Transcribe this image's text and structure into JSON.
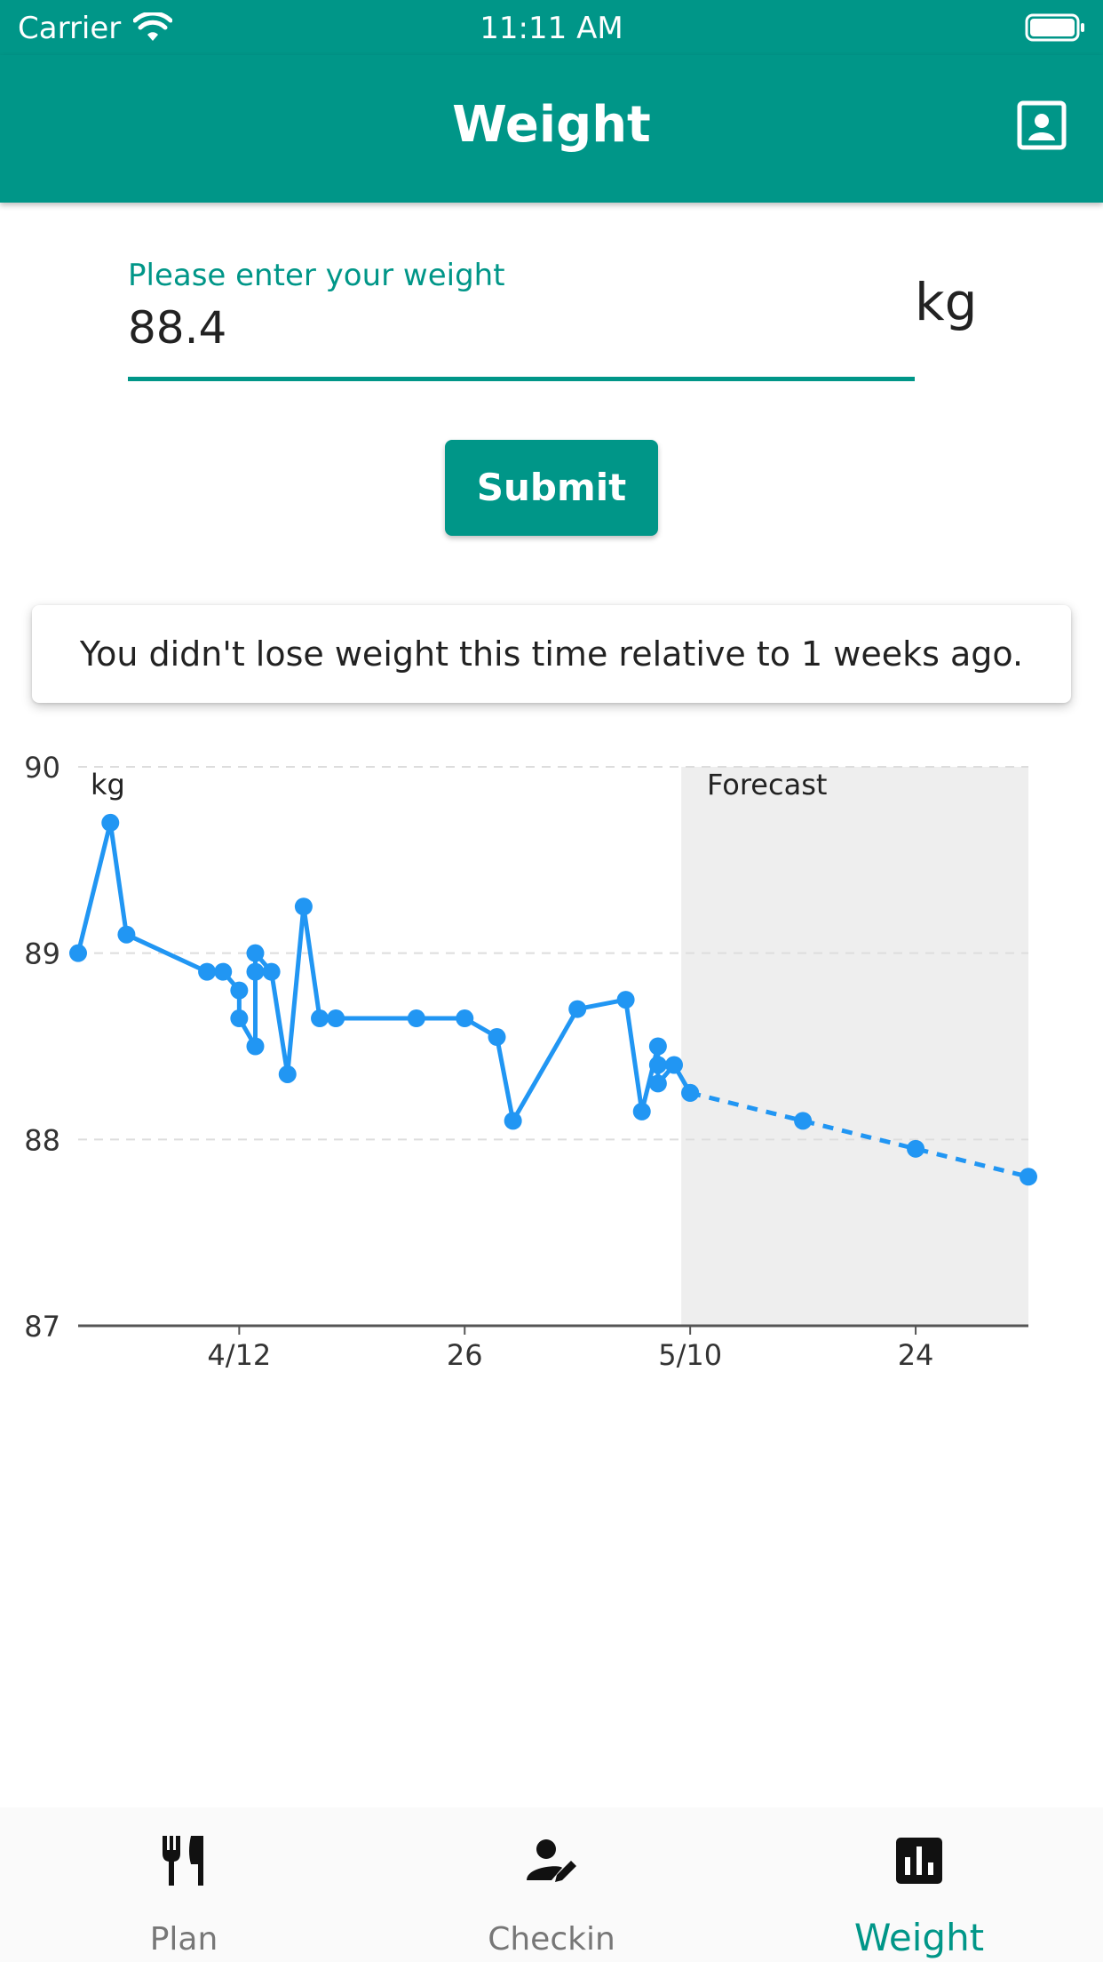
{
  "status_bar": {
    "carrier": "Carrier",
    "time": "11:11 AM"
  },
  "app_bar": {
    "title": "Weight"
  },
  "weight_form": {
    "label": "Please enter your weight",
    "value": "88.4",
    "unit": "kg",
    "submit_label": "Submit"
  },
  "message": "You didn't lose weight this time relative to 1 weeks ago.",
  "chart_data": {
    "type": "line",
    "ylabel": "kg",
    "ylim": [
      87,
      90
    ],
    "y_ticks": [
      "90",
      "89",
      "88",
      "87"
    ],
    "x_ticks": [
      "4/12",
      "26",
      "5/10",
      "24"
    ],
    "forecast_label": "Forecast",
    "colors": {
      "line": "#2196F3",
      "forecast_band": "#EEEEEE",
      "grid": "#DDDDDD",
      "axis": "#555555"
    },
    "series": [
      {
        "kind": "actual",
        "x": [
          "2021-04-02",
          "2021-04-04",
          "2021-04-05",
          "2021-04-10",
          "2021-04-11",
          "2021-04-12",
          "2021-04-12",
          "2021-04-13",
          "2021-04-13",
          "2021-04-13",
          "2021-04-14",
          "2021-04-15",
          "2021-04-16",
          "2021-04-17",
          "2021-04-18",
          "2021-04-23",
          "2021-04-26",
          "2021-04-28",
          "2021-04-29",
          "2021-05-03",
          "2021-05-06",
          "2021-05-07",
          "2021-05-08",
          "2021-05-08",
          "2021-05-08",
          "2021-05-09",
          "2021-05-10"
        ],
        "y": [
          89.0,
          89.7,
          89.1,
          88.9,
          88.9,
          88.8,
          88.65,
          88.5,
          88.9,
          89.0,
          88.9,
          88.35,
          89.25,
          88.65,
          88.65,
          88.65,
          88.65,
          88.55,
          88.1,
          88.7,
          88.75,
          88.15,
          88.5,
          88.4,
          88.3,
          88.4,
          88.25
        ]
      },
      {
        "kind": "forecast",
        "x": [
          "2021-05-10",
          "2021-05-17",
          "2021-05-24",
          "2021-05-31"
        ],
        "y": [
          88.25,
          88.1,
          87.95,
          87.8
        ]
      }
    ]
  },
  "bottom_nav": {
    "items": [
      {
        "label": "Plan",
        "icon": "restaurant-icon"
      },
      {
        "label": "Checkin",
        "icon": "person-edit-icon"
      },
      {
        "label": "Weight",
        "icon": "bar-chart-icon"
      }
    ],
    "active_index": 2
  }
}
